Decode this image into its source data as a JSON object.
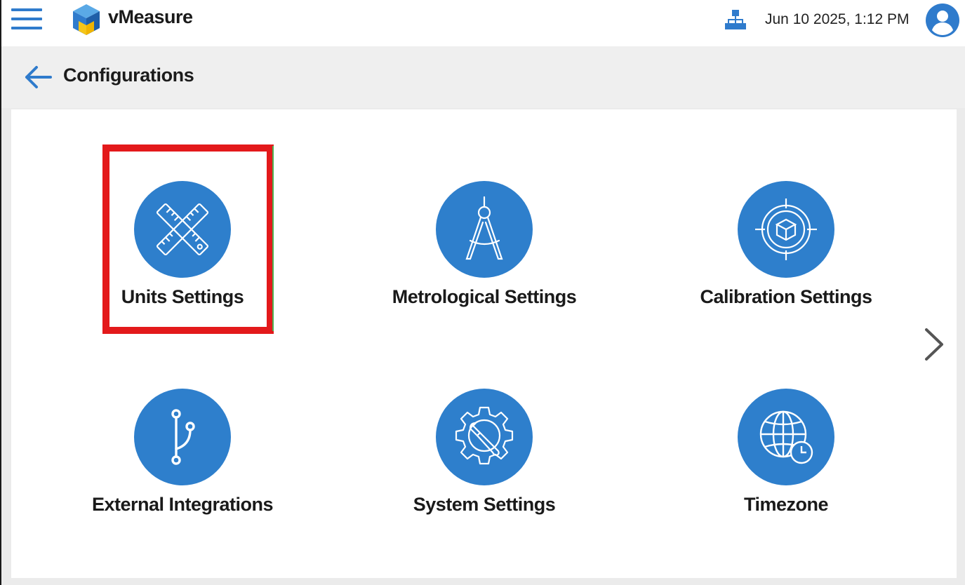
{
  "app": {
    "brand": "vMeasure",
    "datetime": "Jun 10 2025, 1:12 PM"
  },
  "page": {
    "title": "Configurations"
  },
  "tiles": [
    {
      "id": "units-settings",
      "label": "Units Settings",
      "icon": "crossed-rulers-icon"
    },
    {
      "id": "metrological-settings",
      "label": "Metrological Settings",
      "icon": "compass-icon"
    },
    {
      "id": "calibration-settings",
      "label": "Calibration Settings",
      "icon": "target-box-icon"
    },
    {
      "id": "external-integrations",
      "label": "External Integrations",
      "icon": "branch-icon"
    },
    {
      "id": "system-settings",
      "label": "System Settings",
      "icon": "gear-wrench-icon"
    },
    {
      "id": "timezone",
      "label": "Timezone",
      "icon": "globe-clock-icon"
    }
  ],
  "colors": {
    "accent": "#2e7fcc",
    "highlight": "#e3191b",
    "background": "#ebebeb"
  }
}
